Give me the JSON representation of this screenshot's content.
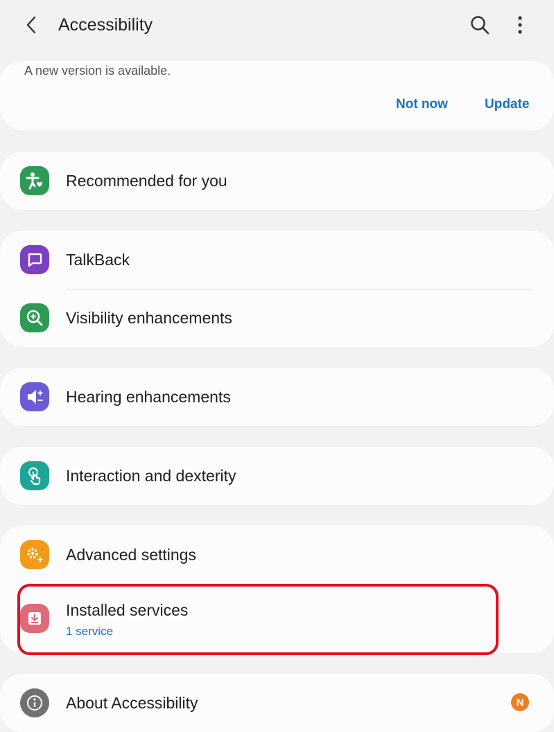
{
  "header": {
    "title": "Accessibility",
    "back_icon": "chevron-left-icon",
    "search_icon": "search-icon",
    "more_icon": "more-vertical-icon"
  },
  "update_card": {
    "message": "A new version is available.",
    "not_now_label": "Not now",
    "update_label": "Update"
  },
  "items": {
    "recommended": {
      "label": "Recommended for you",
      "icon": "accessibility-person-icon",
      "color": "#2e9a55"
    },
    "talkback": {
      "label": "TalkBack",
      "icon": "speech-bubble-icon",
      "color": "#7b3fbf"
    },
    "visibility": {
      "label": "Visibility enhancements",
      "icon": "zoom-plus-icon",
      "color": "#2e9a55"
    },
    "hearing": {
      "label": "Hearing enhancements",
      "icon": "speaker-plus-minus-icon",
      "color": "#6b5bd6"
    },
    "interaction": {
      "label": "Interaction and dexterity",
      "icon": "touch-hand-icon",
      "color": "#1fa596"
    },
    "advanced": {
      "label": "Advanced settings",
      "icon": "gears-plus-icon",
      "color": "#f39a1a"
    },
    "installed": {
      "label": "Installed services",
      "sublabel": "1 service",
      "icon": "download-box-icon",
      "color": "#e06a78"
    },
    "about": {
      "label": "About Accessibility",
      "icon": "info-icon",
      "color": "#707070",
      "badge": "N",
      "badge_color": "#f07d22"
    }
  },
  "colors": {
    "accent": "#1b72c0",
    "background": "#f2f2f2",
    "card": "#fcfcfc",
    "highlight": "#e01020"
  }
}
